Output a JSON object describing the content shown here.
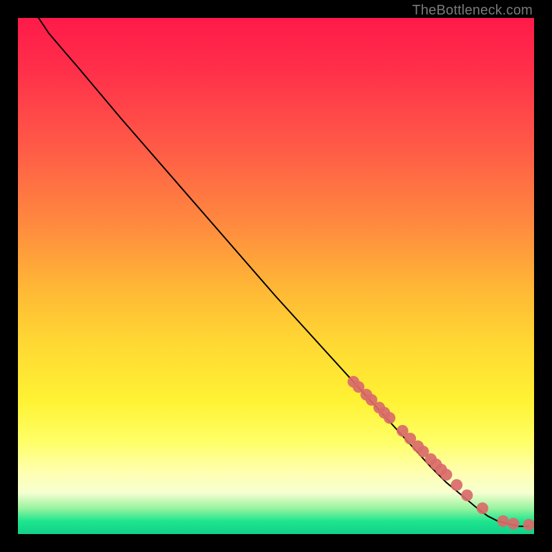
{
  "watermark": "TheBottleneck.com",
  "chart_data": {
    "type": "line",
    "title": "",
    "xlabel": "",
    "ylabel": "",
    "xlim": [
      0,
      100
    ],
    "ylim": [
      0,
      100
    ],
    "grid": false,
    "legend": false,
    "series": [
      {
        "name": "curve",
        "style": "line",
        "color": "#000000",
        "x": [
          4,
          6,
          9,
          12,
          20,
          30,
          40,
          50,
          60,
          65,
          70,
          75,
          80,
          83,
          86,
          89,
          91,
          93,
          95,
          97,
          99
        ],
        "y": [
          100,
          97,
          93.5,
          90,
          80.5,
          69,
          57.5,
          46,
          35,
          29.5,
          24,
          18.5,
          13,
          10,
          7.5,
          5,
          3.5,
          2.5,
          2,
          1.5,
          1.5
        ]
      },
      {
        "name": "points",
        "style": "scatter",
        "color": "#d96a6a",
        "x": [
          65,
          66,
          67.5,
          68.5,
          70,
          71,
          72,
          74.5,
          76,
          77.5,
          78.5,
          80,
          81,
          82,
          83,
          85,
          87,
          90,
          94,
          96,
          99
        ],
        "y": [
          29.5,
          28.5,
          27,
          26,
          24.5,
          23.5,
          22.5,
          20,
          18.5,
          17,
          16,
          14.5,
          13.5,
          12.5,
          11.5,
          9.5,
          7.5,
          5,
          2.5,
          2,
          1.8
        ]
      }
    ]
  },
  "colors": {
    "point_fill": "#d96a6a",
    "line": "#000000"
  }
}
